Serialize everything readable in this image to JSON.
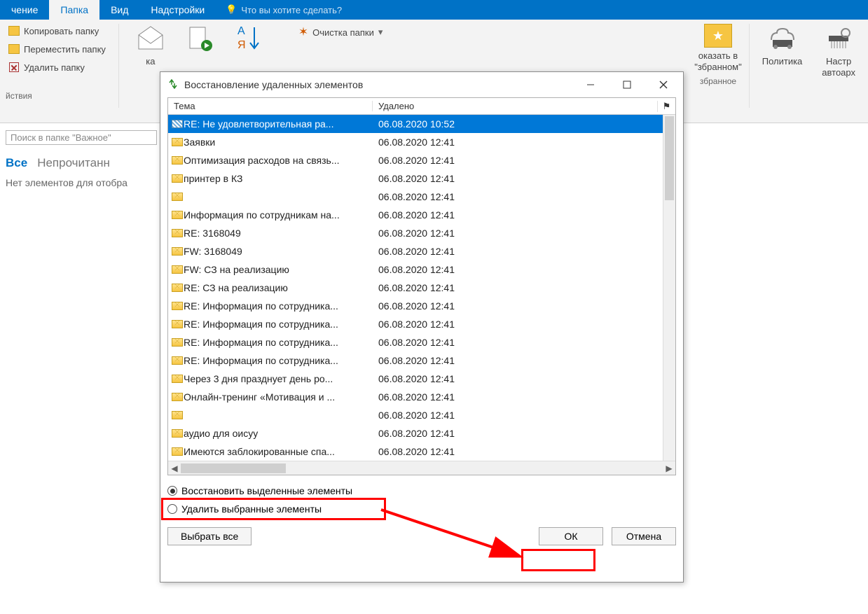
{
  "tabs": {
    "t0": "чение",
    "t1": "Папка",
    "t2": "Вид",
    "t3": "Надстройки",
    "tell_placeholder": "Что вы хотите сделать?"
  },
  "ribbon": {
    "copy_folder": "Копировать папку",
    "move_folder": "Переместить папку",
    "delete_folder": "Удалить папку",
    "actions_group": "йствия",
    "clean_folder": "Очистка папки",
    "show_in_fav_1": "оказать в",
    "show_in_fav_2": "\"збранном\"",
    "fav_group": "збранное",
    "policy": "Политика",
    "autoarchive1": "Настр",
    "autoarchive2": "автоарх"
  },
  "content": {
    "search_placeholder": "Поиск в папке \"Важное\"",
    "filter_all": "Все",
    "filter_unread": "Непрочитанн",
    "no_items": "Нет элементов для отобра"
  },
  "dialog": {
    "title": "Восстановление удаленных элементов",
    "col_theme": "Тема",
    "col_deleted": "Удалено",
    "flag_icon": "⚑",
    "rows": [
      {
        "subject": "RE: Не удовлетворительная ра...",
        "deleted": "06.08.2020 10:52",
        "selected": true
      },
      {
        "subject": "Заявки",
        "deleted": "06.08.2020 12:41"
      },
      {
        "subject": "Оптимизация расходов на связь...",
        "deleted": "06.08.2020 12:41"
      },
      {
        "subject": "принтер в КЗ",
        "deleted": "06.08.2020 12:41"
      },
      {
        "subject": "",
        "deleted": "06.08.2020 12:41"
      },
      {
        "subject": "Информация по сотрудникам на...",
        "deleted": "06.08.2020 12:41"
      },
      {
        "subject": "RE: 3168049",
        "deleted": "06.08.2020 12:41"
      },
      {
        "subject": "FW: 3168049",
        "deleted": "06.08.2020 12:41"
      },
      {
        "subject": "FW: СЗ на реализацию",
        "deleted": "06.08.2020 12:41"
      },
      {
        "subject": "RE: СЗ на реализацию",
        "deleted": "06.08.2020 12:41"
      },
      {
        "subject": "RE: Информация по сотрудника...",
        "deleted": "06.08.2020 12:41"
      },
      {
        "subject": "RE: Информация по сотрудника...",
        "deleted": "06.08.2020 12:41"
      },
      {
        "subject": "RE: Информация по сотрудника...",
        "deleted": "06.08.2020 12:41"
      },
      {
        "subject": "RE: Информация по сотрудника...",
        "deleted": "06.08.2020 12:41"
      },
      {
        "subject": "Через 3 дня празднует день ро...",
        "deleted": "06.08.2020 12:41"
      },
      {
        "subject": "Онлайн-тренинг «Мотивация и ...",
        "deleted": "06.08.2020 12:41"
      },
      {
        "subject": "",
        "deleted": "06.08.2020 12:41"
      },
      {
        "subject": "аудио для оисуу",
        "deleted": "06.08.2020 12:41"
      },
      {
        "subject": "Имеются заблокированные спа...",
        "deleted": "06.08.2020 12:41"
      }
    ],
    "radio_restore": "Восстановить выделенные элементы",
    "radio_delete": "Удалить выбранные элементы",
    "select_all": "Выбрать все",
    "ok": "ОК",
    "cancel": "Отмена"
  }
}
